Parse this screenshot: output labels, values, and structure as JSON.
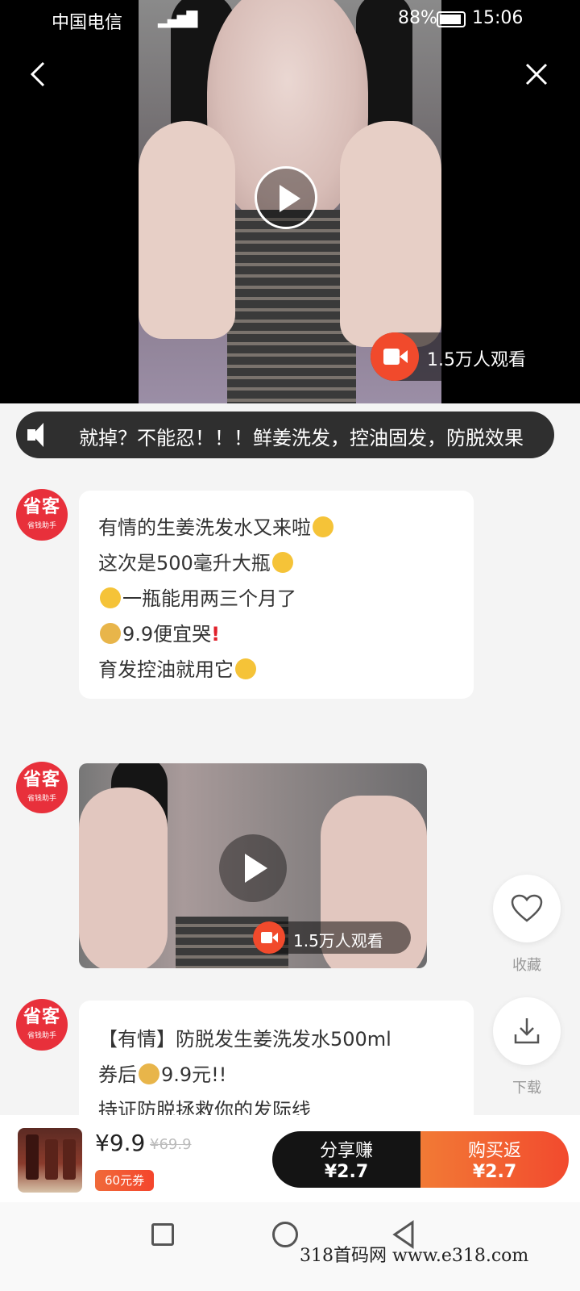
{
  "status_bar": {
    "carrier": "中国电信",
    "battery": "88%",
    "time": "15:06"
  },
  "hero_video": {
    "views": "1.5万人观看"
  },
  "notice": {
    "text": "就掉？不能忍！！！鲜姜洗发，控油固发，防脱效果"
  },
  "avatar": {
    "name": "省客",
    "tagline": "省钱助手"
  },
  "message1": {
    "lines": [
      "有情的生姜洗发水又来啦",
      "这次是500毫升大瓶",
      "一瓶能用两三个月了",
      "9.9便宜哭",
      "育发控油就用它"
    ]
  },
  "video2": {
    "views": "1.5万人观看"
  },
  "message2": {
    "lines": [
      "【有情】防脱发生姜洗发水500ml",
      "券后",
      "9.9元!!",
      "持证防脱拯救你的发际线"
    ]
  },
  "side": {
    "favorite_label": "收藏",
    "download_label": "下载"
  },
  "product": {
    "price": "¥9.9",
    "old_price": "¥69.9",
    "coupon": "60元券",
    "share_label": "分享赚",
    "share_amount": "¥2.7",
    "buy_label": "购买返",
    "buy_amount": "¥2.7"
  },
  "watermark": "318首码网 www.e318.com"
}
